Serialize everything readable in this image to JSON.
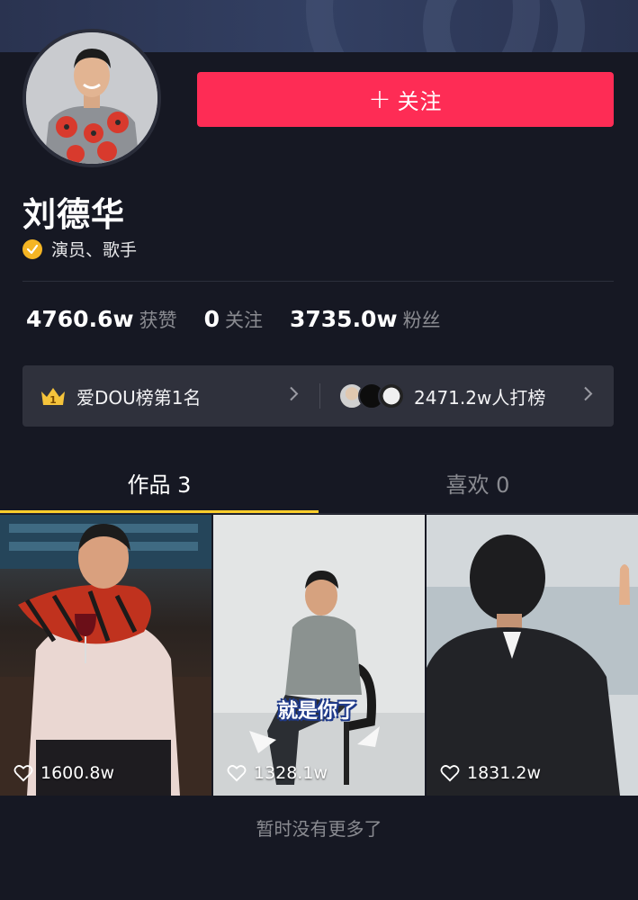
{
  "profile": {
    "name": "刘德华",
    "verification": "演员、歌手",
    "follow_label": "关注",
    "colors": {
      "follow_button": "#fe2c55",
      "verify_badge": "#f5b524",
      "tab_underline": "#fece2c"
    }
  },
  "stats": [
    {
      "value": "4760.6w",
      "label": "获赞"
    },
    {
      "value": "0",
      "label": "关注"
    },
    {
      "value": "3735.0w",
      "label": "粉丝"
    }
  ],
  "rank": {
    "left_text": "爱DOU榜第1名",
    "crown_number": "1",
    "right_text": "2471.2w人打榜",
    "icons": [
      "crown-icon",
      "chevron-right-icon"
    ]
  },
  "tabs": [
    {
      "label": "作品 3",
      "active": true
    },
    {
      "label": "喜欢 0",
      "active": false
    }
  ],
  "videos": [
    {
      "likes": "1600.8w"
    },
    {
      "likes": "1328.1w",
      "caption": "就是你了"
    },
    {
      "likes": "1831.2w"
    }
  ],
  "footer": "暂时没有更多了"
}
